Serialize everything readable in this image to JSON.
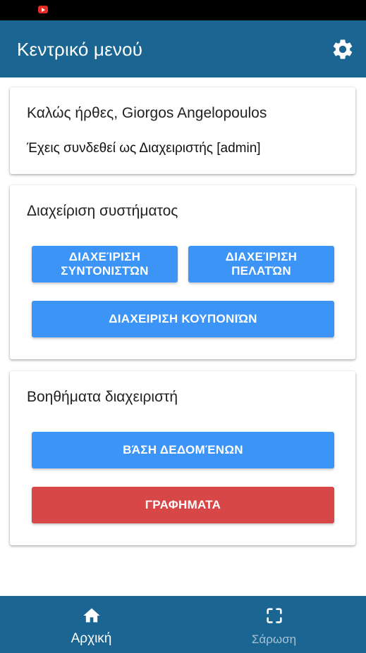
{
  "status_bar": {
    "notification_icon": "youtube-icon"
  },
  "app_bar": {
    "title": "Κεντρικό μενού",
    "settings_icon": "gear-icon"
  },
  "welcome": {
    "greeting": "Καλώς ήρθες, Giorgos Angelopoulos",
    "role_text": "Έχεις συνδεθεί ως Διαχειριστής [admin]"
  },
  "system_management": {
    "title": "Διαχείριση συστήματος",
    "coordinators_button": "ΔΙΑΧΕΊΡΙΣΗ ΣΥΝΤΟΝΙΣΤΏΝ",
    "clients_button": "ΔΙΑΧΕΊΡΙΣΗ ΠΕΛΑΤΏΝ",
    "coupons_button": "ΔΙΑΧΕΙΡΙΣΗ ΚΟΥΠΟΝΙΏΝ"
  },
  "admin_tools": {
    "title": "Βοηθήματα διαχειριστή",
    "database_button": "ΒΆΣΗ ΔΕΔΟΜΈΝΩΝ",
    "charts_button": "ΓΡΑΦΗΜΑΤΑ"
  },
  "bottom_nav": {
    "home_label": "Αρχική",
    "home_icon": "home-icon",
    "scan_label": "Σάρωση",
    "scan_icon": "scan-icon"
  },
  "colors": {
    "primary": "#1a6591",
    "button_blue": "#3c94f7",
    "button_red": "#d84747"
  }
}
